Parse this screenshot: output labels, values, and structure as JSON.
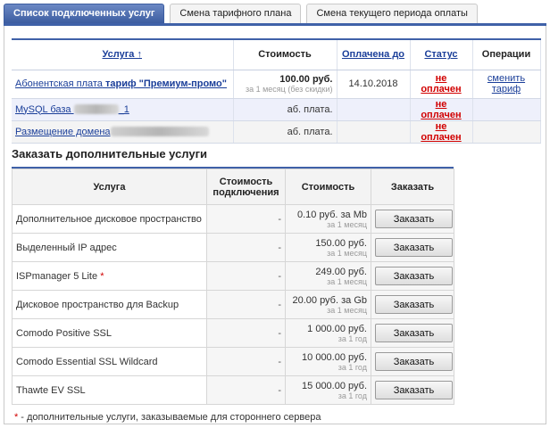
{
  "tabs": [
    {
      "label": "Список подключенных услуг",
      "active": true
    },
    {
      "label": "Смена тарифного плана",
      "active": false
    },
    {
      "label": "Смена текущего периода оплаты",
      "active": false
    }
  ],
  "services": {
    "headers": {
      "service": "Услуга ↑",
      "cost": "Стоимость",
      "paid_until": "Оплачена до",
      "status": "Статус",
      "operations": "Операции"
    },
    "rows": [
      {
        "name_prefix": "Абонентская плата",
        "name_bold": "тариф \"Премиум-промо\"",
        "price": "100.00 руб.",
        "price_note": "за 1 месяц (без скидки)",
        "paid_until": "14.10.2018",
        "status": "не оплачен",
        "operation": "сменить тариф"
      },
      {
        "name_prefix": "MySQL база",
        "name_suffix": "_1",
        "price": "аб. плата.",
        "paid_until": "",
        "status": "не оплачен",
        "operation": ""
      },
      {
        "name_prefix": "Размещение домена",
        "price": "аб. плата.",
        "paid_until": "",
        "status": "не оплачен",
        "operation": ""
      }
    ]
  },
  "order": {
    "title": "Заказать дополнительные услуги",
    "headers": {
      "service": "Услуга",
      "connection": "Стоимость подключения",
      "cost": "Стоимость",
      "order": "Заказать"
    },
    "button_label": "Заказать",
    "rows": [
      {
        "name": "Дополнительное дисковое пространство",
        "connection": "-",
        "price": "0.10 руб. за Mb",
        "period": "за 1 месяц"
      },
      {
        "name": "Выделенный IP адрес",
        "connection": "-",
        "price": "150.00 руб.",
        "period": "за 1 месяц"
      },
      {
        "name": "ISPmanager 5 Lite",
        "required_mark": "*",
        "connection": "-",
        "price": "249.00 руб.",
        "period": "за 1 месяц"
      },
      {
        "name": "Дисковое пространство для Backup",
        "connection": "-",
        "price": "20.00 руб. за Gb",
        "period": "за 1 месяц"
      },
      {
        "name": "Comodo Positive SSL",
        "connection": "-",
        "price": "1 000.00 руб.",
        "period": "за 1 год"
      },
      {
        "name": "Comodo Essential SSL Wildcard",
        "connection": "-",
        "price": "10 000.00 руб.",
        "period": "за 1 год"
      },
      {
        "name": "Thawte EV SSL",
        "connection": "-",
        "price": "15 000.00 руб.",
        "period": "за 1 год"
      }
    ]
  },
  "footnote": {
    "mark": "*",
    "text": "- дополнительные услуги, заказываемые для стороннего сервера"
  },
  "colors": {
    "accent": "#3f61a8",
    "unpaid": "#d10000",
    "link": "#1a3e99"
  }
}
